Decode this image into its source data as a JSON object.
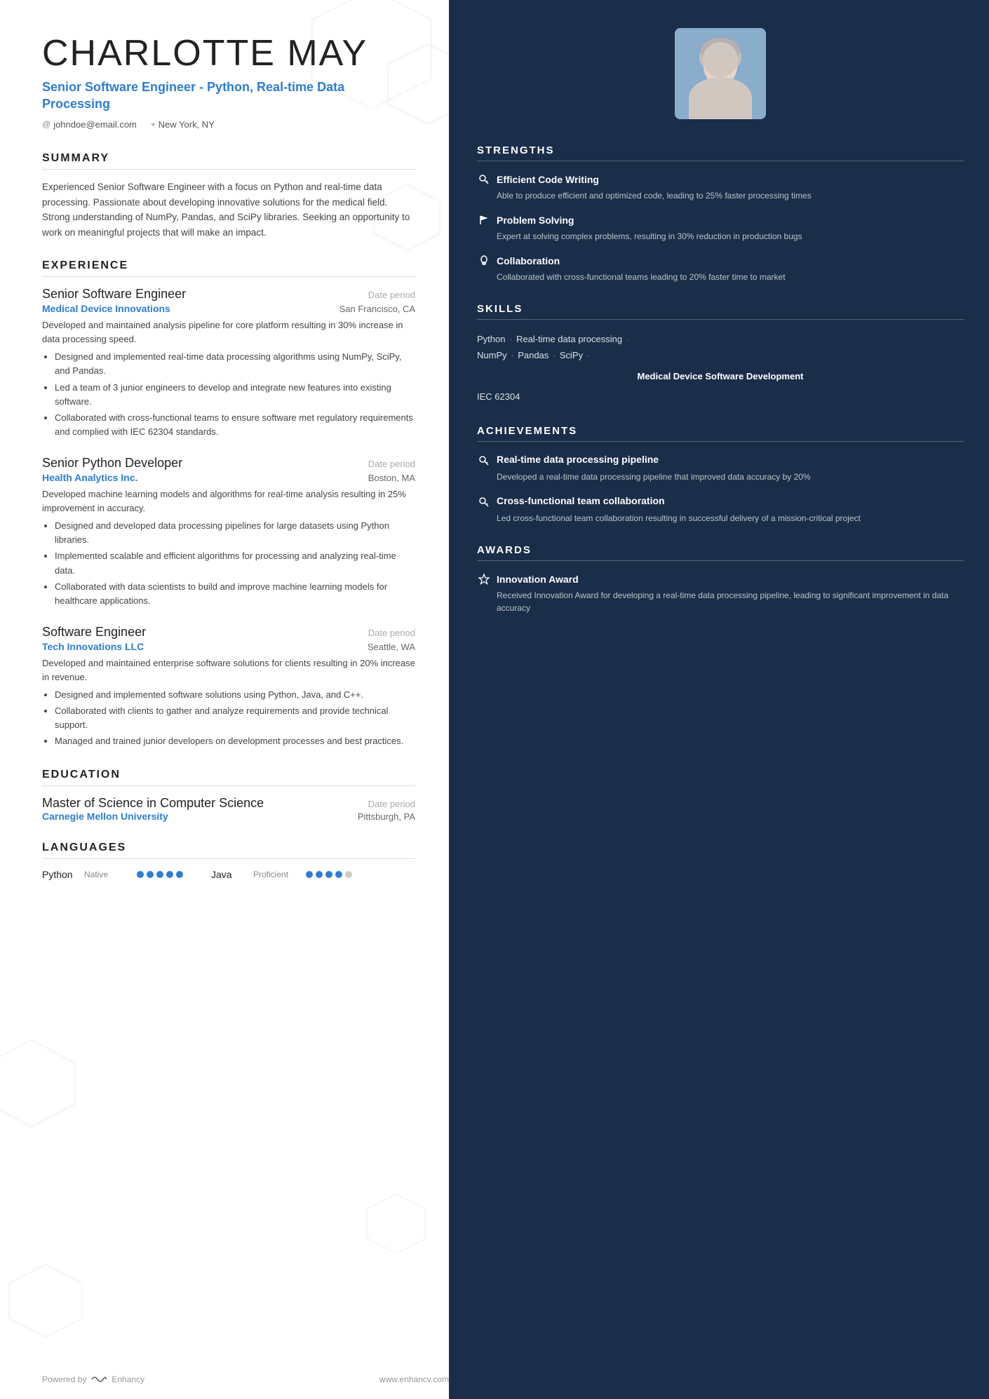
{
  "header": {
    "name": "CHARLOTTE MAY",
    "job_title": "Senior Software Engineer - Python, Real-time Data Processing",
    "email": "johndoe@email.com",
    "location": "New York, NY"
  },
  "summary": {
    "title": "SUMMARY",
    "text": "Experienced Senior Software Engineer with a focus on Python and real-time data processing. Passionate about developing innovative solutions for the medical field. Strong understanding of NumPy, Pandas, and SciPy libraries. Seeking an opportunity to work on meaningful projects that will make an impact."
  },
  "experience": {
    "title": "EXPERIENCE",
    "entries": [
      {
        "role": "Senior Software Engineer",
        "date": "Date period",
        "company": "Medical Device Innovations",
        "location": "San Francisco, CA",
        "description": "Developed and maintained analysis pipeline for core platform resulting in 30% increase in data processing speed.",
        "bullets": [
          "Designed and implemented real-time data processing algorithms using NumPy, SciPy, and Pandas.",
          "Led a team of 3 junior engineers to develop and integrate new features into existing software.",
          "Collaborated with cross-functional teams to ensure software met regulatory requirements and complied with IEC 62304 standards."
        ]
      },
      {
        "role": "Senior Python Developer",
        "date": "Date period",
        "company": "Health Analytics Inc.",
        "location": "Boston, MA",
        "description": "Developed machine learning models and algorithms for real-time analysis resulting in 25% improvement in accuracy.",
        "bullets": [
          "Designed and developed data processing pipelines for large datasets using Python libraries.",
          "Implemented scalable and efficient algorithms for processing and analyzing real-time data.",
          "Collaborated with data scientists to build and improve machine learning models for healthcare applications."
        ]
      },
      {
        "role": "Software Engineer",
        "date": "Date period",
        "company": "Tech Innovations LLC",
        "location": "Seattle, WA",
        "description": "Developed and maintained enterprise software solutions for clients resulting in 20% increase in revenue.",
        "bullets": [
          "Designed and implemented software solutions using Python, Java, and C++.",
          "Collaborated with clients to gather and analyze requirements and provide technical support.",
          "Managed and trained junior developers on development processes and best practices."
        ]
      }
    ]
  },
  "education": {
    "title": "EDUCATION",
    "entries": [
      {
        "degree": "Master of Science in Computer Science",
        "date": "Date period",
        "school": "Carnegie Mellon University",
        "location": "Pittsburgh, PA"
      }
    ]
  },
  "languages": {
    "title": "LANGUAGES",
    "entries": [
      {
        "name": "Python",
        "level": "Native",
        "dots_filled": 5,
        "dots_total": 5
      },
      {
        "name": "Java",
        "level": "Proficient",
        "dots_filled": 4,
        "dots_total": 5
      }
    ]
  },
  "footer": {
    "powered_by": "Powered by",
    "brand": "Enhancy",
    "website": "www.enhancv.com"
  },
  "right": {
    "strengths": {
      "title": "STRENGTHS",
      "items": [
        {
          "icon": "🔑",
          "name": "Efficient Code Writing",
          "desc": "Able to produce efficient and optimized code, leading to 25% faster processing times"
        },
        {
          "icon": "⚑",
          "name": "Problem Solving",
          "desc": "Expert at solving complex problems, resulting in 30% reduction in production bugs"
        },
        {
          "icon": "💡",
          "name": "Collaboration",
          "desc": "Collaborated with cross-functional teams leading to 20% faster time to market"
        }
      ]
    },
    "skills": {
      "title": "SKILLS",
      "lines": [
        "Python · Real-time data processing ·",
        "NumPy · Pandas · SciPy ·",
        "Medical Device Software Development",
        "IEC 62304"
      ]
    },
    "achievements": {
      "title": "ACHIEVEMENTS",
      "items": [
        {
          "icon": "🔑",
          "name": "Real-time data processing pipeline",
          "desc": "Developed a real-time data processing pipeline that improved data accuracy by 20%"
        },
        {
          "icon": "🔑",
          "name": "Cross-functional team collaboration",
          "desc": "Led cross-functional team collaboration resulting in successful delivery of a mission-critical project"
        }
      ]
    },
    "awards": {
      "title": "AWARDS",
      "items": [
        {
          "icon": "✦",
          "name": "Innovation Award",
          "desc": "Received Innovation Award for developing a real-time data processing pipeline, leading to significant improvement in data accuracy"
        }
      ]
    }
  }
}
